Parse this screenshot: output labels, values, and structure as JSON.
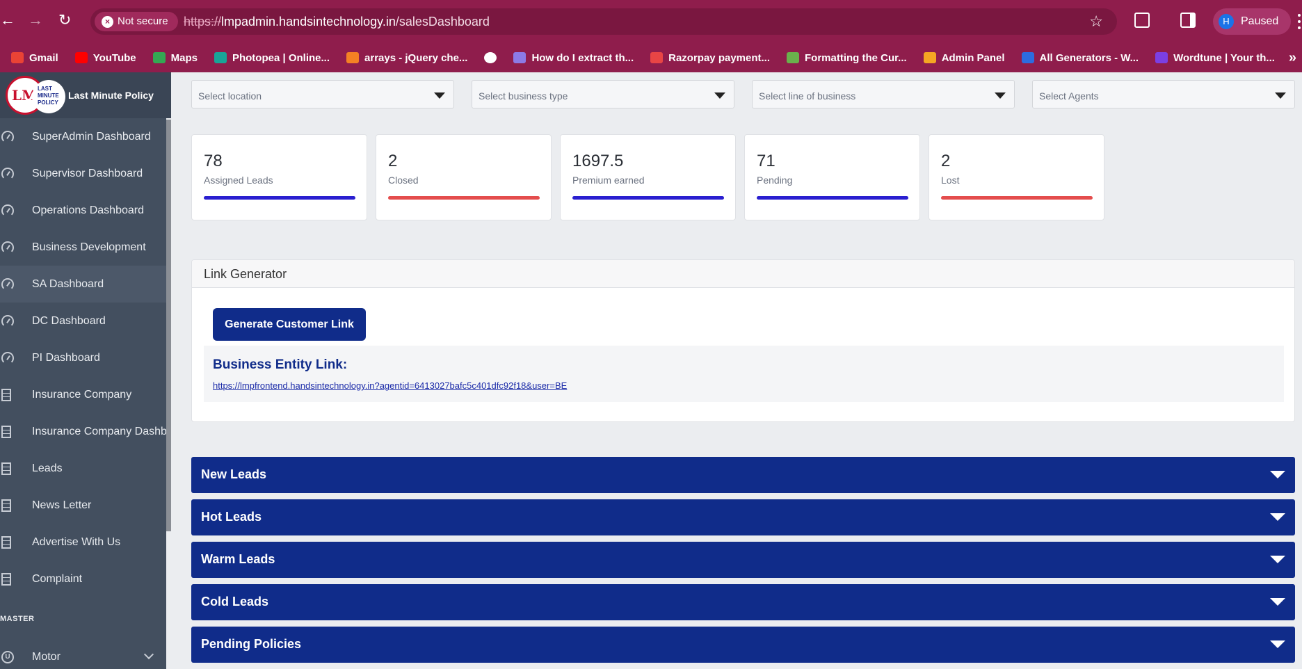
{
  "browser": {
    "back_icon": "←",
    "forward_icon": "→",
    "reload_icon": "↻",
    "not_secure": "Not secure",
    "url_scheme": "https://",
    "url_host": "lmpadmin.handsintechnology.in",
    "url_path": "/salesDashboard",
    "star_icon": "☆",
    "profile_initial": "H",
    "profile_status": "Paused",
    "bookmarks_more": "»",
    "bookmarks": [
      {
        "label": "Gmail",
        "color": "#ea4335"
      },
      {
        "label": "YouTube",
        "color": "#ff0000"
      },
      {
        "label": "Maps",
        "color": "#34a853"
      },
      {
        "label": "Photopea | Online...",
        "color": "#18a497"
      },
      {
        "label": "arrays - jQuery che...",
        "color": "#f48024"
      },
      {
        "label": "",
        "color": "#ffffff"
      },
      {
        "label": "How do I extract th...",
        "color": "#8c7ae6"
      },
      {
        "label": "Razorpay payment...",
        "color": "#e84545"
      },
      {
        "label": "Formatting the Cur...",
        "color": "#6ab04c"
      },
      {
        "label": "Admin Panel",
        "color": "#f5a623"
      },
      {
        "label": "All Generators - W...",
        "color": "#2d6cdf"
      },
      {
        "label": "Wordtune | Your th...",
        "color": "#7b3fe4"
      }
    ]
  },
  "sidebar": {
    "brand_name": "Last Minute Policy",
    "logo_mark": "LMP",
    "logo_words": [
      "LAST",
      "MINUTE",
      "POLICY"
    ],
    "items": [
      {
        "label": "SuperAdmin Dashboard",
        "icon": "gauge-icon"
      },
      {
        "label": "Supervisor Dashboard",
        "icon": "gauge-icon"
      },
      {
        "label": "Operations Dashboard",
        "icon": "gauge-icon"
      },
      {
        "label": "Business Development",
        "icon": "gauge-icon"
      },
      {
        "label": "SA Dashboard",
        "icon": "gauge-icon"
      },
      {
        "label": "DC Dashboard",
        "icon": "gauge-icon"
      },
      {
        "label": "PI Dashboard",
        "icon": "gauge-icon"
      },
      {
        "label": "Insurance Company",
        "icon": "building-icon"
      },
      {
        "label": "Insurance Company Dashb",
        "icon": "building-icon"
      },
      {
        "label": "Leads",
        "icon": "building-icon"
      },
      {
        "label": "News Letter",
        "icon": "building-icon"
      },
      {
        "label": "Advertise With Us",
        "icon": "building-icon"
      },
      {
        "label": "Complaint",
        "icon": "building-icon"
      }
    ],
    "section_label": "MASTER",
    "motor_label": "Motor"
  },
  "filters": [
    {
      "placeholder": "Select location"
    },
    {
      "placeholder": "Select business type"
    },
    {
      "placeholder": "Select line of business"
    },
    {
      "placeholder": "Select Agents"
    }
  ],
  "stats": [
    {
      "value": "78",
      "label": "Assigned Leads",
      "color": "#2a1fd0"
    },
    {
      "value": "2",
      "label": "Closed",
      "color": "#e44d4d"
    },
    {
      "value": "1697.5",
      "label": "Premium earned",
      "color": "#2a1fd0"
    },
    {
      "value": "71",
      "label": "Pending",
      "color": "#2a1fd0"
    },
    {
      "value": "2",
      "label": "Lost",
      "color": "#e44d4d"
    }
  ],
  "link_generator": {
    "title": "Link Generator",
    "button_label": "Generate Customer Link",
    "entity_title": "Business Entity Link:",
    "entity_url": "https://lmpfrontend.handsintechnology.in?agentid=6413027bafc5c401dfc92f18&user=BE"
  },
  "accordions": [
    {
      "label": "New Leads"
    },
    {
      "label": "Hot Leads"
    },
    {
      "label": "Warm Leads"
    },
    {
      "label": "Cold Leads"
    },
    {
      "label": "Pending Policies"
    }
  ]
}
